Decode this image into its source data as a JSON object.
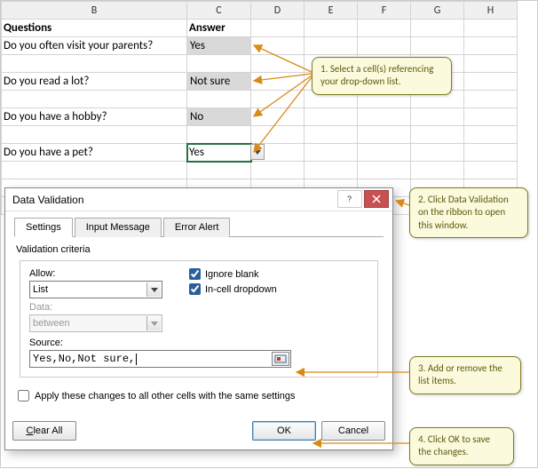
{
  "columns": [
    "B",
    "C",
    "D",
    "E",
    "F",
    "G",
    "H"
  ],
  "headers": {
    "questions": "Questions",
    "answer": "Answer"
  },
  "rows": [
    {
      "q": "Do you often visit your parents?",
      "a": "Yes"
    },
    {
      "q": "",
      "a": ""
    },
    {
      "q": "Do you read a lot?",
      "a": "Not sure"
    },
    {
      "q": "",
      "a": ""
    },
    {
      "q": "Do you have a hobby?",
      "a": "No"
    },
    {
      "q": "",
      "a": ""
    },
    {
      "q": "",
      "a": ""
    },
    {
      "q": "Do you have a pet?",
      "a": "Yes"
    }
  ],
  "dialog": {
    "title": "Data Validation",
    "tabs": {
      "settings": "Settings",
      "input": "Input Message",
      "error": "Error Alert"
    },
    "criteria_label": "Validation criteria",
    "allow_label": "Allow:",
    "allow_value": "List",
    "data_label": "Data:",
    "data_value": "between",
    "ignore_blank": "Ignore blank",
    "incell": "In-cell dropdown",
    "source_label": "Source:",
    "source_value": "Yes,No,Not sure,",
    "apply_label": "Apply these changes to all other cells with the same settings",
    "clear_label_pre": "",
    "clear_key": "C",
    "clear_label_post": "lear All",
    "ok": "OK",
    "cancel": "Cancel"
  },
  "callouts": {
    "c1": "1. Select a cell(s)  referencing your drop-down list.",
    "c2": "2. Click Data Validation on the ribbon to open this window.",
    "c3": "3. Add or remove the list items.",
    "c4": "4. Click OK to save the changes."
  }
}
